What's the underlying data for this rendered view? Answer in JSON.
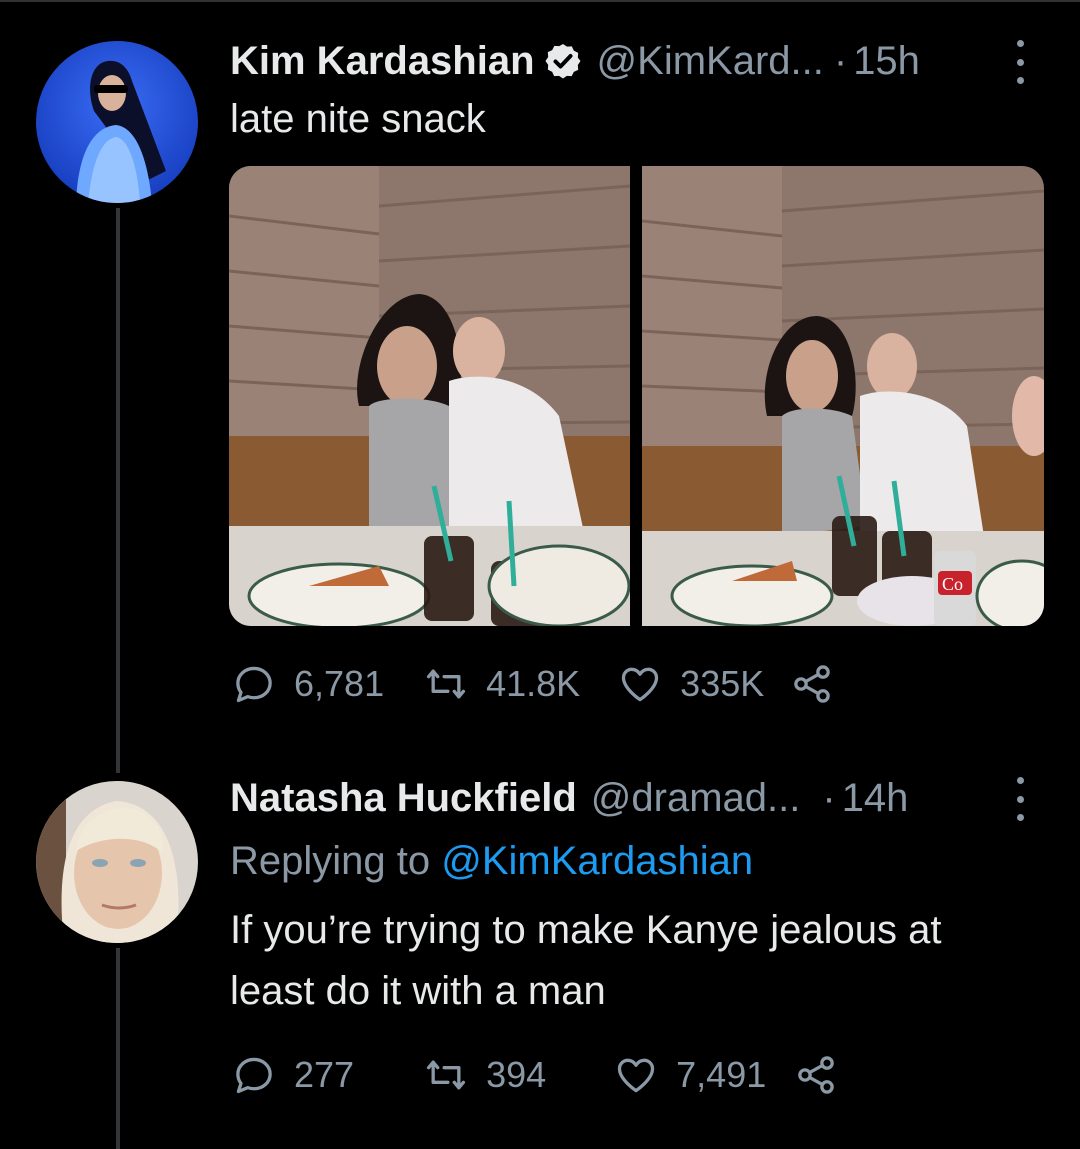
{
  "tweet": {
    "author_name": "Kim Kardashian",
    "handle": "@KimKard...",
    "separator": "·",
    "time": "15h",
    "text": "late nite snack",
    "verified_icon": "verified-badge-icon",
    "photo_overlay_text": "Co",
    "stats": {
      "replies": "6,781",
      "retweets": "41.8K",
      "likes": "335K"
    }
  },
  "reply": {
    "author_name": "Natasha Huckfield",
    "handle": "@dramad...",
    "separator": "·",
    "time": "14h",
    "replying_prefix": "Replying to",
    "replying_to": "@KimKardashian",
    "text_line1": "If you’re trying to make Kanye jealous at",
    "text_line2": "least do it with a man",
    "stats": {
      "replies": "277",
      "retweets": "394",
      "likes": "7,491"
    }
  },
  "colors": {
    "background": "#000000",
    "text": "#e7e9ea",
    "secondary": "#8b98a5",
    "link": "#1d9bf0",
    "thread_line": "#333639"
  },
  "icons": [
    "reply-icon",
    "retweet-icon",
    "like-icon",
    "share-icon",
    "more-icon",
    "verified-badge-icon"
  ]
}
